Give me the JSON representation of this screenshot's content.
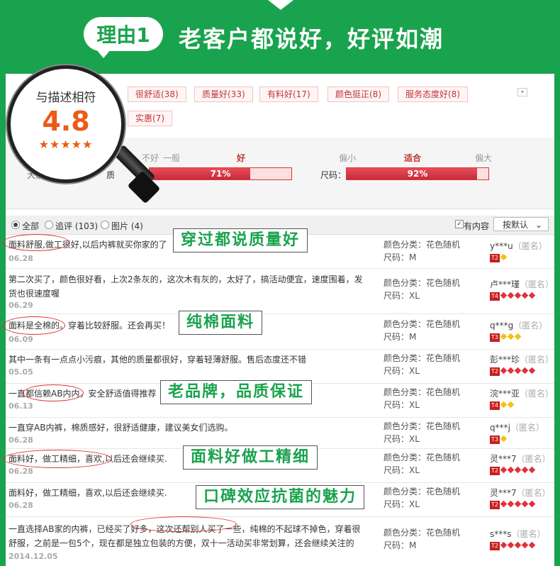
{
  "header": {
    "badge": "理由1",
    "title": "老客户都说好，好评如潮"
  },
  "tags": [
    "很舒适(38)",
    "质量好(33)",
    "有料好(17)",
    "颜色挺正(8)",
    "服务态度好(8)",
    "实惠(7)"
  ],
  "rating": {
    "label": "与描述相符",
    "score": "4.8",
    "stars": "★★★★★",
    "partial_label": "大家认",
    "quality": {
      "prefix": "质",
      "labels": [
        "不好",
        "一般",
        "好"
      ],
      "percent_text": "71%",
      "fill_fraction": 0.71
    },
    "size": {
      "prefix": "尺码：",
      "labels": [
        "偏小",
        "适合",
        "偏大"
      ],
      "percent_text": "92%",
      "fill_fraction": 0.92
    }
  },
  "filters": {
    "all": "全部",
    "followup": "追评 (103)",
    "images": "图片 (4)",
    "has_content": "有内容",
    "sort": "按默认"
  },
  "reviews": [
    {
      "text": "面料舒服,做工很好,以后内裤就买你家的了",
      "date": "06.28",
      "spec1": "颜色分类：花色随机",
      "spec2": "尺码：M",
      "user": "y***u",
      "anon": "（匿名）",
      "level": "T2",
      "gem_color": "#f1c40f",
      "gems": 1
    },
    {
      "text": "第二次买了，颜色很好看，上次2条灰的，这次木有灰的，太好了，搞活动便宜，速度围着，发货也很速度喔",
      "date": "06.29",
      "spec1": "颜色分类：花色随机",
      "spec2": "尺码：XL",
      "user": "卢***瑾",
      "anon": "（匿名）",
      "level": "T4",
      "gem_color": "#e0313d",
      "gems": 5
    },
    {
      "text": "面料是全棉的。穿着比较舒服。还会再买！",
      "date": "06.09",
      "spec1": "颜色分类：花色随机",
      "spec2": "尺码：M",
      "user": "q***g",
      "anon": "（匿名）",
      "level": "T3",
      "gem_color": "#f1c40f",
      "gems": 3
    },
    {
      "text": "其中一条有一点点小污痕，其他的质量都很好，穿着轻薄舒服。售后态度还不错",
      "date": "05.05",
      "spec1": "颜色分类：花色随机",
      "spec2": "尺码：XL",
      "user": "彭***珍",
      "anon": "（匿名）",
      "level": "T2",
      "gem_color": "#e0313d",
      "gems": 5
    },
    {
      "text": "一直都信赖AB内内，安全舒适值得推荐",
      "date": "06.13",
      "spec1": "颜色分类：花色随机",
      "spec2": "尺码：XL",
      "user": "浣***亚",
      "anon": "（匿名）",
      "level": "T4",
      "gem_color": "#f1c40f",
      "gems": 2
    },
    {
      "text": "一直穿AB内裤，棉质感好，很舒适健康，建议美女们选购。",
      "date": "06.28",
      "spec1": "颜色分类：花色随机",
      "spec2": "尺码：XL",
      "user": "q***j",
      "anon": "（匿名）",
      "level": "T3",
      "gem_color": "#f1c40f",
      "gems": 1
    },
    {
      "text": "面料好，做工精细，喜欢,以后还会继续买.",
      "date": "06.28",
      "spec1": "颜色分类：花色随机",
      "spec2": "尺码：XL",
      "user": "灵***7",
      "anon": "（匿名）",
      "level": "T2",
      "gem_color": "#e0313d",
      "gems": 5
    },
    {
      "text": "面料好，做工精细，喜欢,以后还会继续买.",
      "date": "06.28",
      "spec1": "颜色分类：花色随机",
      "spec2": "尺码：XL",
      "user": "灵***7",
      "anon": "（匿名）",
      "level": "T2",
      "gem_color": "#e0313d",
      "gems": 5
    },
    {
      "text": "一直选择AB家的内裤，已经买了好多，这次还帮别人买了一些，纯棉的不起球不掉色，穿着很舒服，之前是一包5个，现在都是独立包装的方便，双十一活动买非常划算，还会继续关注的",
      "date": "2014.12.05",
      "spec1": "颜色分类：花色随机",
      "spec2": "尺码：M",
      "user": "s***s",
      "anon": "（匿名）",
      "level": "T2",
      "gem_color": "#e0313d",
      "gems": 5
    }
  ],
  "annotations": [
    "穿过都说质量好",
    "纯棉面料",
    "老品牌，品质保证",
    "面料好做工精细",
    "口碑效应抗菌的魅力"
  ],
  "colors": {
    "brand_green": "#1aa34e",
    "bar_red": "#c52b3b",
    "score_orange": "#ec5b16"
  }
}
